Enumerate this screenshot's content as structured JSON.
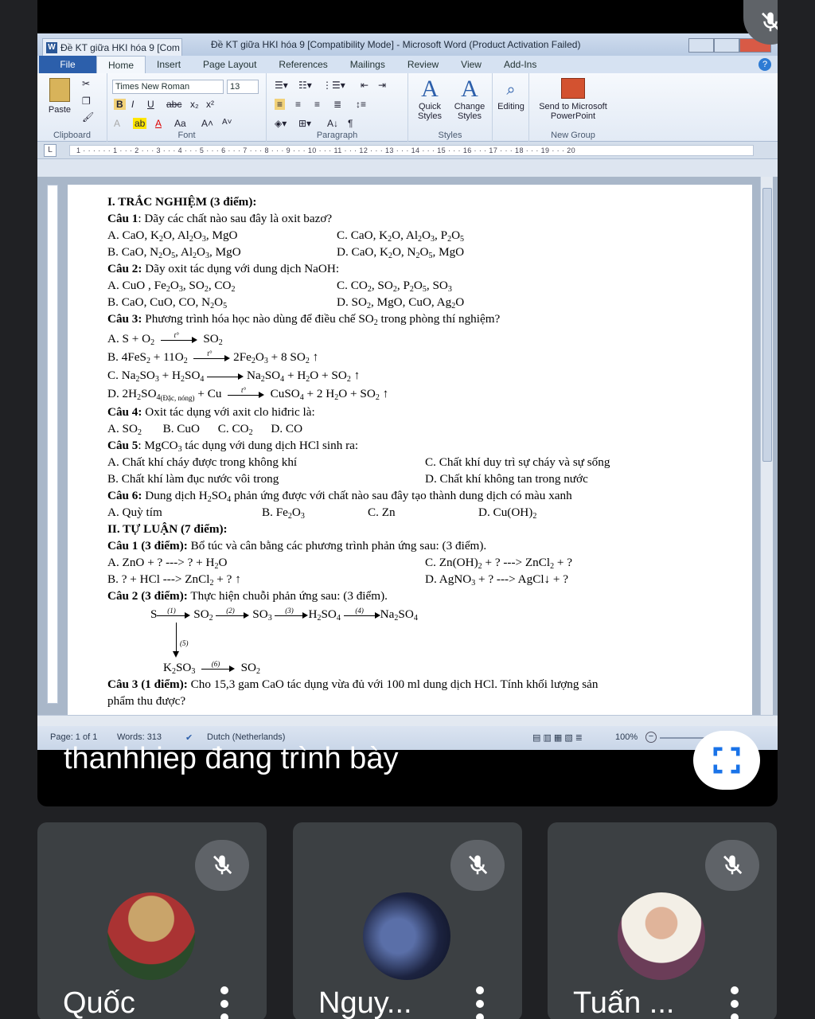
{
  "word": {
    "doc_tab_title": "Đề KT giữa HKI hóa 9 [Com",
    "window_title": "Đề KT giữa HKI hóa 9 [Compatibility Mode] - Microsoft Word (Product Activation Failed)",
    "tabs": [
      "File",
      "Home",
      "Insert",
      "Page Layout",
      "References",
      "Mailings",
      "Review",
      "View",
      "Add-Ins"
    ],
    "help": "?",
    "ribbon": {
      "font_name": "Times New Roman",
      "font_size": "13",
      "paste": "Paste",
      "clipboard": "Clipboard",
      "font_group": "Font",
      "paragraph_group": "Paragraph",
      "styles_group": "Styles",
      "quick_styles": "Quick Styles",
      "change_styles": "Change Styles",
      "editing": "Editing",
      "send_to_ppt": "Send to Microsoft PowerPoint",
      "new_group": "New Group"
    },
    "ruler_text": "1 · · · · · · 1 · · · 2 · · · 3 · · · 4 · · · 5 · · · 6 · · · 7 · · · 8 · · · 9 · · · 10 · · · 11 · · · 12 · · · 13 · · · 14 · · · 15 · · · 16 · · · 17 · · · 18 · · · 19 · · · 20",
    "status": {
      "page": "Page: 1 of 1",
      "words": "Words: 313",
      "language": "Dutch (Netherlands)",
      "zoom": "100%"
    }
  },
  "doc": {
    "s1_title": "I. TRẮC NGHIỆM (3 điểm):",
    "q1_label": "Câu 1",
    "q1_text": ": Dãy các chất nào sau đây là oxit bazơ?",
    "q2_label": "Câu 2:",
    "q2_text": " Dãy oxit tác dụng với dung dịch NaOH:",
    "q3_label": "Câu 3:",
    "q3_text": " Phương trình hóa học nào dùng để điều chế SO",
    "q3_text_end": " trong phòng thí nghiệm?",
    "q4_label": "Câu 4:",
    "q4_text": " Oxit tác dụng với axit clo hiđric là:",
    "q5_label": "Câu 5",
    "q5_text": ": MgCO",
    "q5_text_end": " tác dụng với dung dịch HCl sinh ra:",
    "q5_a": "A. Chất khí cháy được trong không khí",
    "q5_b": "B. Chất khí làm đục nước vôi trong",
    "q5_c": "C. Chất khí duy trì sự cháy và sự sống",
    "q5_d": "D. Chất khí không tan trong nước",
    "q6_label": "Câu 6:",
    "q6_text": " Dung dịch H",
    "q6_text_end": " phản ứng được với chất nào sau đây tạo thành dung dịch có màu xanh",
    "q6_a": "A. Quỳ tím",
    "s2_title": "II. TỰ LUẬN (7 điểm):",
    "e1_label": "Câu 1 (3 điểm):",
    "e1_text": " Bổ túc và cân bằng các phương trình phản ứng sau: (3 điểm).",
    "e2_label": "Câu 2 (3 điểm):",
    "e2_text": " Thực hiện chuỗi phản ứng sau: (3 điểm).",
    "e3_label": "Câu 3 (1 điểm):",
    "e3_text": " Cho 15,3 gam CaO tác dụng vừa đủ với 100 ml dung dịch HCl. Tính khối lượng sản",
    "e3_text2": "phẩm thu được?",
    "reaction_dac_nong": "(Đặc, nóng)",
    "chain_labels": [
      "(1)",
      "(2)",
      "(3)",
      "(4)",
      "(5)",
      "(6)"
    ]
  },
  "meet": {
    "presenter": "thanhhiep đang trình bày",
    "participants": [
      {
        "name": "Quốc"
      },
      {
        "name": "Nguy..."
      },
      {
        "name": "Tuấn ..."
      }
    ]
  }
}
